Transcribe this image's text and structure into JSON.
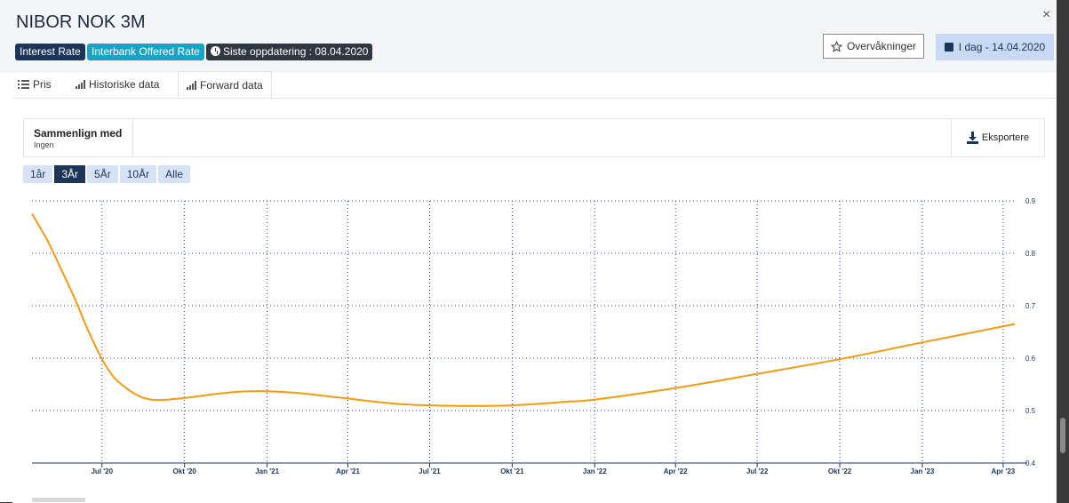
{
  "header": {
    "title": "NIBOR NOK 3M",
    "badges": {
      "type": "Interest Rate",
      "category": "Interbank Offered Rate",
      "updated": "Siste oppdatering : 08.04.2020"
    },
    "watch_label": "Overvåkninger",
    "date_label": "I dag - 14.04.2020",
    "close_glyph": "×"
  },
  "tabs": [
    {
      "label": "Pris",
      "icon": "list-icon"
    },
    {
      "label": "Historiske data",
      "icon": "bar-chart-icon"
    },
    {
      "label": "Forward data",
      "icon": "bar-chart-icon",
      "active": true
    }
  ],
  "compare": {
    "label": "Sammenlign med",
    "value": "Ingen"
  },
  "export_label": "Eksportere",
  "ranges": [
    "1år",
    "3År",
    "5År",
    "10År",
    "Alle"
  ],
  "active_range": "3År",
  "colors": {
    "line": "#f29a12",
    "navy": "#1d3559",
    "grid": "#2d3f8a"
  },
  "chart_data": {
    "type": "line",
    "x_tick_labels": [
      "Jul '20",
      "Okt '20",
      "Jan '21",
      "Apr '21",
      "Jul '21",
      "Okt '21",
      "Jan '22",
      "Apr '22",
      "Jul '22",
      "Okt '22",
      "Jan '23",
      "Apr '23"
    ],
    "y_tick_labels": [
      "0.4",
      "0.5",
      "0.6",
      "0.7",
      "0.8",
      "0.9"
    ],
    "ylim": [
      0.4,
      0.9
    ],
    "xlim": [
      "2020-04-14",
      "2023-04-14"
    ],
    "grid": true,
    "y_axis_side": "right",
    "series": [
      {
        "x": [
          "2020-04-14",
          "2020-05-01",
          "2020-05-15",
          "2020-06-01",
          "2020-06-15",
          "2020-07-01",
          "2020-07-15",
          "2020-08-01",
          "2020-08-15",
          "2020-09-01",
          "2020-10-01",
          "2020-11-01",
          "2020-12-01",
          "2021-01-01",
          "2021-02-01",
          "2021-03-01",
          "2021-04-01",
          "2021-05-01",
          "2021-06-01",
          "2021-07-01",
          "2021-08-01",
          "2021-09-01",
          "2021-10-01",
          "2021-11-01",
          "2021-12-01",
          "2022-01-01",
          "2022-04-01",
          "2022-07-01",
          "2022-10-01",
          "2023-01-01",
          "2023-04-14"
        ],
        "y": [
          0.875,
          0.825,
          0.775,
          0.712,
          0.655,
          0.598,
          0.562,
          0.538,
          0.525,
          0.52,
          0.524,
          0.531,
          0.536,
          0.537,
          0.534,
          0.529,
          0.523,
          0.517,
          0.512,
          0.51,
          0.509,
          0.509,
          0.51,
          0.513,
          0.517,
          0.521,
          0.543,
          0.57,
          0.598,
          0.63,
          0.665
        ]
      }
    ]
  }
}
